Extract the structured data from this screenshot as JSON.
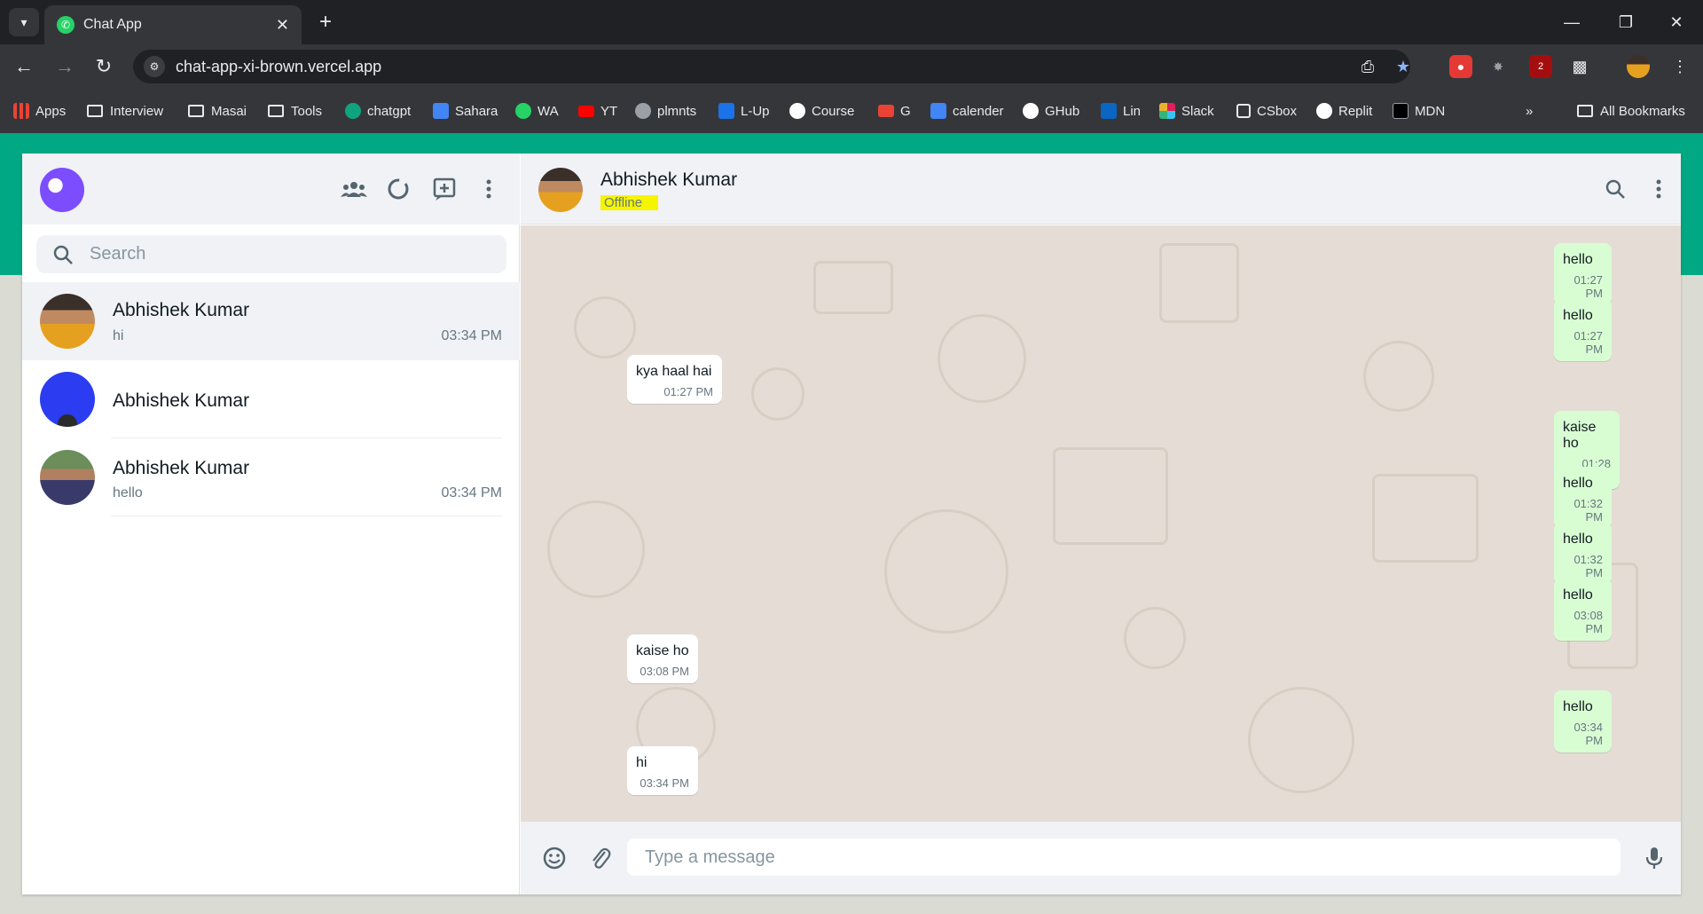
{
  "browser": {
    "tab_title": "Chat App",
    "url": "chat-app-xi-brown.vercel.app",
    "bookmarks": [
      {
        "label": "Apps",
        "icon": "apps-grid-icon",
        "color": "#ea4335"
      },
      {
        "label": "Interview",
        "icon": "folder-icon"
      },
      {
        "label": "Masai",
        "icon": "folder-icon"
      },
      {
        "label": "Tools",
        "icon": "folder-icon"
      },
      {
        "label": "chatgpt",
        "icon": "chatgpt-icon",
        "color": "#10a37f"
      },
      {
        "label": "Sahara",
        "icon": "doc-icon",
        "color": "#4285f4"
      },
      {
        "label": "WA",
        "icon": "whatsapp-icon",
        "color": "#25d366"
      },
      {
        "label": "YT",
        "icon": "youtube-icon",
        "color": "#ff0000"
      },
      {
        "label": "plmnts",
        "icon": "globe-icon",
        "color": "#9aa0a6"
      },
      {
        "label": "L-Up",
        "icon": "lu-icon",
        "color": "#1a73e8"
      },
      {
        "label": "Course",
        "icon": "m-logo-icon",
        "color": "#ffffff"
      },
      {
        "label": "G",
        "icon": "gmail-icon",
        "color": "#ea4335"
      },
      {
        "label": "calender",
        "icon": "calendar-icon",
        "color": "#4285f4"
      },
      {
        "label": "GHub",
        "icon": "github-icon",
        "color": "#ffffff"
      },
      {
        "label": "Lin",
        "icon": "linkedin-icon",
        "color": "#0a66c2"
      },
      {
        "label": "Slack",
        "icon": "slack-icon",
        "color": "#e01e5a"
      },
      {
        "label": "CSbox",
        "icon": "square-icon",
        "color": "#35363a"
      },
      {
        "label": "Replit",
        "icon": "replit-icon",
        "color": "#ffffff"
      },
      {
        "label": "MDN",
        "icon": "mdn-icon",
        "color": "#000000"
      }
    ],
    "all_bookmarks": "All Bookmarks",
    "ext_badge": "2"
  },
  "app": {
    "accent": "#00a884",
    "search": {
      "placeholder": "Search"
    },
    "chats": [
      {
        "name": "Abhishek Kumar",
        "last": "hi",
        "time": "03:34 PM",
        "active": true
      },
      {
        "name": "Abhishek Kumar",
        "last": "",
        "time": "",
        "active": false
      },
      {
        "name": "Abhishek Kumar",
        "last": "hello",
        "time": "03:34 PM",
        "active": false
      }
    ],
    "conversation": {
      "name": "Abhishek Kumar",
      "status": "Offline",
      "messages": [
        {
          "dir": "out",
          "text": "hello",
          "time": "01:27 PM"
        },
        {
          "dir": "out",
          "text": "hello",
          "time": "01:27 PM"
        },
        {
          "dir": "in",
          "text": "kya haal hai",
          "time": "01:27 PM"
        },
        {
          "dir": "out",
          "text": "kaise ho",
          "time": "01:28 PM"
        },
        {
          "dir": "out",
          "text": "hello",
          "time": "01:32 PM"
        },
        {
          "dir": "out",
          "text": "hello",
          "time": "01:32 PM"
        },
        {
          "dir": "out",
          "text": "hello",
          "time": "03:08 PM"
        },
        {
          "dir": "in",
          "text": "kaise ho",
          "time": "03:08 PM"
        },
        {
          "dir": "out",
          "text": "hello",
          "time": "03:34 PM"
        },
        {
          "dir": "in",
          "text": "hi",
          "time": "03:34 PM"
        }
      ]
    },
    "composer": {
      "placeholder": "Type a message"
    }
  }
}
